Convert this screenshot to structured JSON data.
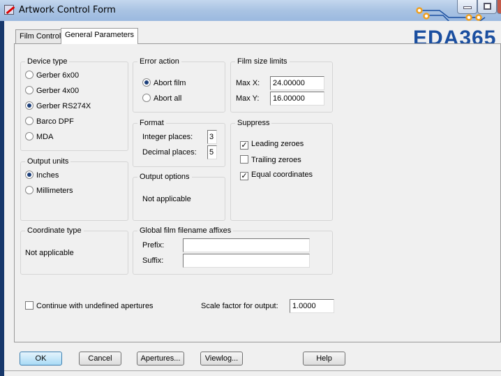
{
  "window": {
    "title": "Artwork Control Form"
  },
  "logo": {
    "text": "EDA365",
    "color": "#1b4fa0"
  },
  "tabs": [
    {
      "label": "Film Control"
    },
    {
      "label": "General Parameters"
    }
  ],
  "device_type": {
    "title": "Device type",
    "options": [
      "Gerber 6x00",
      "Gerber 4x00",
      "Gerber RS274X",
      "Barco DPF",
      "MDA"
    ],
    "selected": "Gerber RS274X"
  },
  "output_units": {
    "title": "Output units",
    "options": [
      "Inches",
      "Millimeters"
    ],
    "selected": "Inches"
  },
  "coordinate_type": {
    "title": "Coordinate type",
    "value": "Not applicable"
  },
  "error_action": {
    "title": "Error action",
    "options": [
      "Abort film",
      "Abort all"
    ],
    "selected": "Abort film"
  },
  "format": {
    "title": "Format",
    "integer_label": "Integer places:",
    "integer_value": "3",
    "decimal_label": "Decimal places:",
    "decimal_value": "5"
  },
  "output_options": {
    "title": "Output options",
    "value": "Not applicable"
  },
  "film_size": {
    "title": "Film size limits",
    "max_x_label": "Max X:",
    "max_x": "24.00000",
    "max_y_label": "Max Y:",
    "max_y": "16.00000"
  },
  "suppress": {
    "title": "Suppress",
    "items": [
      {
        "label": "Leading zeroes",
        "checked": true
      },
      {
        "label": "Trailing zeroes",
        "checked": false
      },
      {
        "label": "Equal coordinates",
        "checked": true
      }
    ]
  },
  "affixes": {
    "title": "Global film filename affixes",
    "prefix_label": "Prefix:",
    "prefix": "",
    "suffix_label": "Suffix:",
    "suffix": ""
  },
  "continue_undefined": {
    "label": "Continue with undefined apertures",
    "checked": false
  },
  "scale": {
    "label": "Scale factor for output:",
    "value": "1.0000"
  },
  "buttons": {
    "ok": "OK",
    "cancel": "Cancel",
    "apertures": "Apertures...",
    "viewlog": "Viewlog...",
    "help": "Help"
  }
}
